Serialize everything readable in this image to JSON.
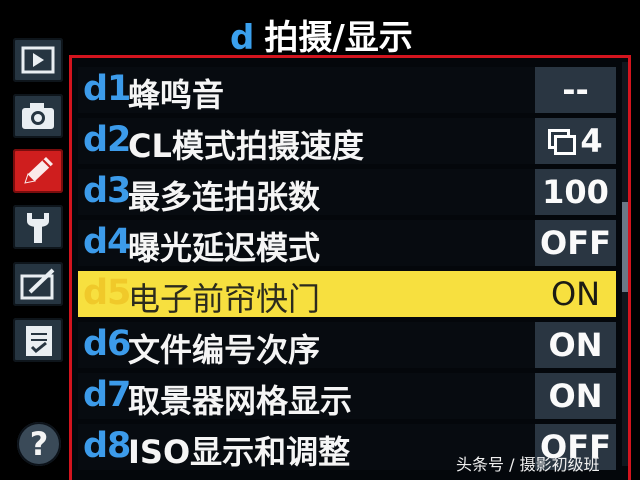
{
  "header": {
    "menu_letter": "d",
    "title": "拍摄/显示"
  },
  "sidebar": {
    "items": [
      {
        "icon": "playback-icon",
        "active": false
      },
      {
        "icon": "camera-icon",
        "active": false
      },
      {
        "icon": "pencil-icon",
        "active": true
      },
      {
        "icon": "wrench-icon",
        "active": false
      },
      {
        "icon": "retouch-icon",
        "active": false
      },
      {
        "icon": "my-menu-icon",
        "active": false
      }
    ],
    "help_label": "?"
  },
  "menu": {
    "items": [
      {
        "code": "d1",
        "label": "蜂鸣音",
        "value": "--"
      },
      {
        "code": "d2",
        "label": "CL模式拍摄速度",
        "value": "4",
        "value_icon": "continuous-low-icon"
      },
      {
        "code": "d3",
        "label": "最多连拍张数",
        "value": "100"
      },
      {
        "code": "d4",
        "label": "曝光延迟模式",
        "value": "OFF"
      },
      {
        "code": "d5",
        "label": "电子前帘快门",
        "value": "ON",
        "selected": true
      },
      {
        "code": "d6",
        "label": "文件编号次序",
        "value": "ON"
      },
      {
        "code": "d7",
        "label": "取景器网格显示",
        "value": "ON"
      },
      {
        "code": "d8",
        "label": "ISO显示和调整",
        "value": "OFF"
      }
    ]
  },
  "watermark": "头条号 / 摄影初级班",
  "colors": {
    "accent_blue": "#3c9bea",
    "selection_yellow": "#f7e03f",
    "frame_red": "#d3141e",
    "value_box": "#2a3642"
  }
}
